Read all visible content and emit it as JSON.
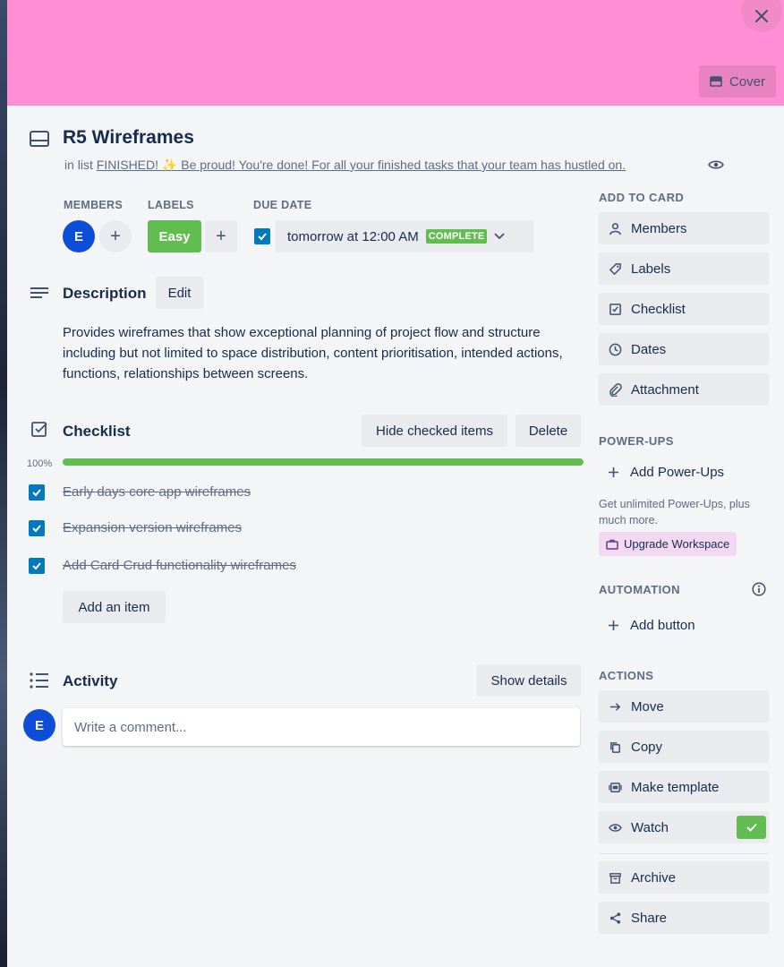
{
  "header": {
    "close_icon": "close-icon",
    "cover_label": "Cover",
    "cover_color": "#ff8ed4"
  },
  "card": {
    "title": "R5 Wireframes",
    "in_list_prefix": "in list",
    "list_name": "FINISHED! ✨ Be proud! You're done! For all your finished tasks that your team has hustled on."
  },
  "members": {
    "label": "MEMBERS",
    "avatar_initial": "E",
    "add_symbol": "+"
  },
  "labels": {
    "label": "LABELS",
    "items": [
      "Easy"
    ],
    "add_symbol": "+",
    "easy_color": "#61bd4f"
  },
  "due_date": {
    "label": "DUE DATE",
    "checked": true,
    "value": "tomorrow at 12:00 AM",
    "status": "COMPLETE"
  },
  "description": {
    "title": "Description",
    "edit_label": "Edit",
    "text": "Provides wireframes that show exceptional planning of project flow and structure including but not limited to space distribution, content prioritisation, intended actions, functions, relationships between screens."
  },
  "checklist": {
    "title": "Checklist",
    "hide_checked_label": "Hide checked items",
    "delete_label": "Delete",
    "progress_label": "100%",
    "progress": 1.0,
    "items": [
      {
        "text": "Early days core app wireframes",
        "checked": true
      },
      {
        "text": "Expansion version wireframes",
        "checked": true
      },
      {
        "text": "Add Card Crud functionality wireframes",
        "checked": true
      }
    ],
    "add_item_label": "Add an item"
  },
  "activity": {
    "title": "Activity",
    "show_details_label": "Show details",
    "avatar_initial": "E",
    "comment_placeholder": "Write a comment..."
  },
  "sidebar": {
    "add_to_card": {
      "heading": "ADD TO CARD",
      "items": [
        {
          "label": "Members",
          "icon": "person-icon"
        },
        {
          "label": "Labels",
          "icon": "tag-icon"
        },
        {
          "label": "Checklist",
          "icon": "checklist-icon"
        },
        {
          "label": "Dates",
          "icon": "clock-icon"
        },
        {
          "label": "Attachment",
          "icon": "paperclip-icon"
        }
      ]
    },
    "power_ups": {
      "heading": "POWER-UPS",
      "add_label": "Add Power-Ups",
      "note": "Get unlimited Power-Ups, plus much more.",
      "upgrade_label": "Upgrade Workspace"
    },
    "automation": {
      "heading": "AUTOMATION",
      "add_button_label": "Add button"
    },
    "actions": {
      "heading": "ACTIONS",
      "items": [
        {
          "label": "Move",
          "icon": "arrow-right-icon"
        },
        {
          "label": "Copy",
          "icon": "copy-icon"
        },
        {
          "label": "Make template",
          "icon": "template-icon"
        },
        {
          "label": "Watch",
          "icon": "eye-icon",
          "active": true
        },
        {
          "label": "Archive",
          "icon": "archive-icon"
        },
        {
          "label": "Share",
          "icon": "share-icon"
        }
      ]
    }
  }
}
